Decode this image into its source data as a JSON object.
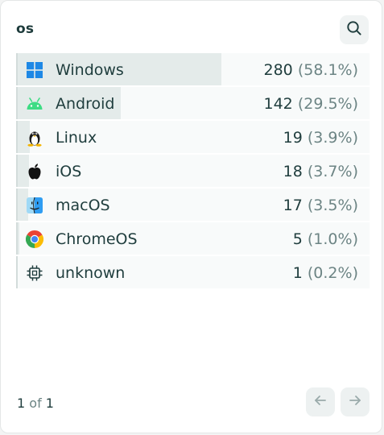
{
  "panel": {
    "title": "os",
    "search_icon": "search-icon"
  },
  "rows": [
    {
      "label": "Windows",
      "count": "280",
      "pct": "(58.1%)",
      "share": 0.581,
      "icon": "windows-icon"
    },
    {
      "label": "Android",
      "count": "142",
      "pct": "(29.5%)",
      "share": 0.295,
      "icon": "android-icon"
    },
    {
      "label": "Linux",
      "count": "19",
      "pct": "(3.9%)",
      "share": 0.039,
      "icon": "linux-icon"
    },
    {
      "label": "iOS",
      "count": "18",
      "pct": "(3.7%)",
      "share": 0.037,
      "icon": "apple-icon"
    },
    {
      "label": "macOS",
      "count": "17",
      "pct": "(3.5%)",
      "share": 0.035,
      "icon": "finder-icon"
    },
    {
      "label": "ChromeOS",
      "count": "5",
      "pct": "(1.0%)",
      "share": 0.01,
      "icon": "chrome-icon"
    },
    {
      "label": "unknown",
      "count": "1",
      "pct": "(0.2%)",
      "share": 0.002,
      "icon": "chip-icon"
    }
  ],
  "pager": {
    "current": "1",
    "of_word": "of",
    "total": "1",
    "prev_icon": "arrow-left-icon",
    "next_icon": "arrow-right-icon"
  },
  "colors": {
    "windows": "#1e88e5",
    "android": "#3ddc84",
    "text": "#1f3d3d",
    "muted": "#6c8484",
    "bar": "#e4ebea"
  }
}
